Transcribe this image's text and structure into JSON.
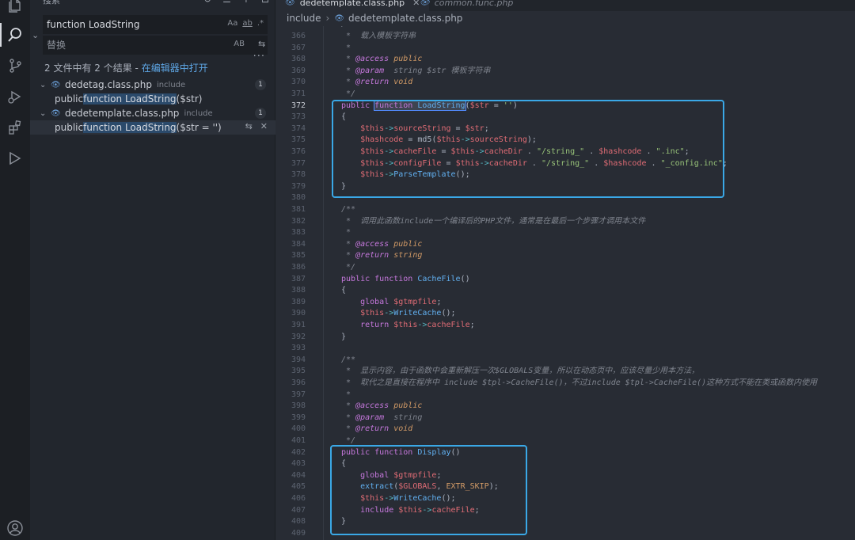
{
  "activity_bar": {
    "icons": [
      "files-icon",
      "search-icon",
      "source-control-icon",
      "run-debug-icon",
      "extensions-icon",
      "remote-icon",
      "account-icon"
    ]
  },
  "sidebar": {
    "title": "搜索",
    "search": {
      "value": "function LoadString",
      "opt_case": "Aa",
      "opt_word": "ab",
      "opt_regex": ".*"
    },
    "replace": {
      "placeholder": "替换",
      "opt_preserve": "AB"
    },
    "summary": {
      "text": "2 文件中有 2 个结果 - ",
      "link": "在编辑器中打开"
    },
    "results": [
      {
        "file": "dedetag.class.php",
        "dir": "include",
        "count": "1",
        "match": {
          "before": "public ",
          "hit": "function LoadString",
          "after": "($str)"
        }
      },
      {
        "file": "dedetemplate.class.php",
        "dir": "include",
        "count": "1",
        "match": {
          "before": "public ",
          "hit": "function LoadString",
          "after": "($str = '')"
        }
      }
    ]
  },
  "editor": {
    "tabs": [
      {
        "label": "dedetemplate.class.php",
        "active": true
      },
      {
        "label": "common.func.php",
        "active": false
      }
    ],
    "breadcrumb": {
      "folder": "include",
      "file": "dedetemplate.class.php"
    },
    "current_line": "372",
    "lines": [
      {
        "n": "365",
        "t": "    /**"
      },
      {
        "n": "366",
        "t": "     *  载入模板字符串"
      },
      {
        "n": "367",
        "t": "     *"
      },
      {
        "n": "368",
        "t": "     * @access public"
      },
      {
        "n": "369",
        "t": "     * @param  string $str 模板字符串"
      },
      {
        "n": "370",
        "t": "     * @return void"
      },
      {
        "n": "371",
        "t": "     */"
      },
      {
        "n": "372",
        "t": "    public function LoadString($str = '')"
      },
      {
        "n": "373",
        "t": "    {"
      },
      {
        "n": "374",
        "t": "        $this->sourceString = $str;"
      },
      {
        "n": "375",
        "t": "        $hashcode = md5($this->sourceString);"
      },
      {
        "n": "376",
        "t": "        $this->cacheFile = $this->cacheDir . \"/string_\" . $hashcode . \".inc\";"
      },
      {
        "n": "377",
        "t": "        $this->configFile = $this->cacheDir . \"/string_\" . $hashcode . \"_config.inc\";"
      },
      {
        "n": "378",
        "t": "        $this->ParseTemplate();"
      },
      {
        "n": "379",
        "t": "    }"
      },
      {
        "n": "380",
        "t": ""
      },
      {
        "n": "381",
        "t": "    /**"
      },
      {
        "n": "382",
        "t": "     *  调用此函数include一个编译后的PHP文件，通常是在最后一个步骤才调用本文件"
      },
      {
        "n": "383",
        "t": "     *"
      },
      {
        "n": "384",
        "t": "     * @access public"
      },
      {
        "n": "385",
        "t": "     * @return string"
      },
      {
        "n": "386",
        "t": "     */"
      },
      {
        "n": "387",
        "t": "    public function CacheFile()"
      },
      {
        "n": "388",
        "t": "    {"
      },
      {
        "n": "389",
        "t": "        global $gtmpfile;"
      },
      {
        "n": "390",
        "t": "        $this->WriteCache();"
      },
      {
        "n": "391",
        "t": "        return $this->cacheFile;"
      },
      {
        "n": "392",
        "t": "    }"
      },
      {
        "n": "393",
        "t": ""
      },
      {
        "n": "394",
        "t": "    /**"
      },
      {
        "n": "395",
        "t": "     *  显示内容，由于函数中会重新解压一次$GLOBALS变量，所以在动态页中，应该尽量少用本方法，"
      },
      {
        "n": "396",
        "t": "     *  取代之是直接在程序中 include $tpl->CacheFile()，不过include $tpl->CacheFile()这种方式不能在类或函数内使用"
      },
      {
        "n": "397",
        "t": "     *"
      },
      {
        "n": "398",
        "t": "     * @access public"
      },
      {
        "n": "399",
        "t": "     * @param  string"
      },
      {
        "n": "400",
        "t": "     * @return void"
      },
      {
        "n": "401",
        "t": "     */"
      },
      {
        "n": "402",
        "t": "    public function Display()"
      },
      {
        "n": "403",
        "t": "    {"
      },
      {
        "n": "404",
        "t": "        global $gtmpfile;"
      },
      {
        "n": "405",
        "t": "        extract($GLOBALS, EXTR_SKIP);"
      },
      {
        "n": "406",
        "t": "        $this->WriteCache();"
      },
      {
        "n": "407",
        "t": "        include $this->cacheFile;"
      },
      {
        "n": "408",
        "t": "    }"
      },
      {
        "n": "409",
        "t": ""
      }
    ]
  },
  "colors": {
    "accent": "#3aa8e6",
    "link": "#5ea7e6",
    "keyword": "#c678dd",
    "function": "#61afef",
    "variable": "#e06c75",
    "string": "#98c379"
  }
}
